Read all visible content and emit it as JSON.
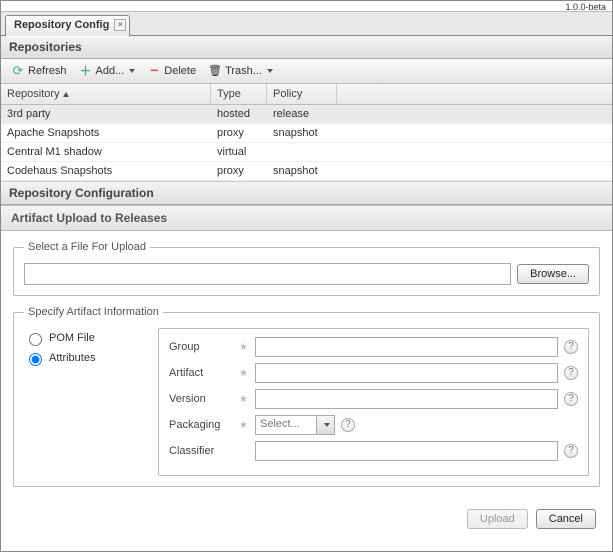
{
  "version_label": "1.0.0-beta",
  "tab_title": "Repository Config",
  "sections": {
    "repositories": "Repositories",
    "repo_config": "Repository Configuration",
    "artifact_upload": "Artifact Upload to Releases"
  },
  "toolbar": {
    "refresh": "Refresh",
    "add": "Add...",
    "delete": "Delete",
    "trash": "Trash..."
  },
  "grid": {
    "columns": [
      "Repository",
      "Type",
      "Policy"
    ],
    "rows": [
      {
        "repo": "3rd party",
        "type": "hosted",
        "policy": "release",
        "selected": true
      },
      {
        "repo": "Apache Snapshots",
        "type": "proxy",
        "policy": "snapshot",
        "selected": false
      },
      {
        "repo": "Central M1 shadow",
        "type": "virtual",
        "policy": "",
        "selected": false
      },
      {
        "repo": "Codehaus Snapshots",
        "type": "proxy",
        "policy": "snapshot",
        "selected": false
      }
    ]
  },
  "upload": {
    "fieldset_label": "Select a File For Upload",
    "browse": "Browse..."
  },
  "spec": {
    "fieldset_label": "Specify Artifact Information",
    "radio_pom": "POM File",
    "radio_attr": "Attributes",
    "labels": {
      "group": "Group",
      "artifact": "Artifact",
      "version": "Version",
      "packaging": "Packaging",
      "classifier": "Classifier"
    },
    "packaging_placeholder": "Select..."
  },
  "footer": {
    "upload": "Upload",
    "cancel": "Cancel"
  }
}
